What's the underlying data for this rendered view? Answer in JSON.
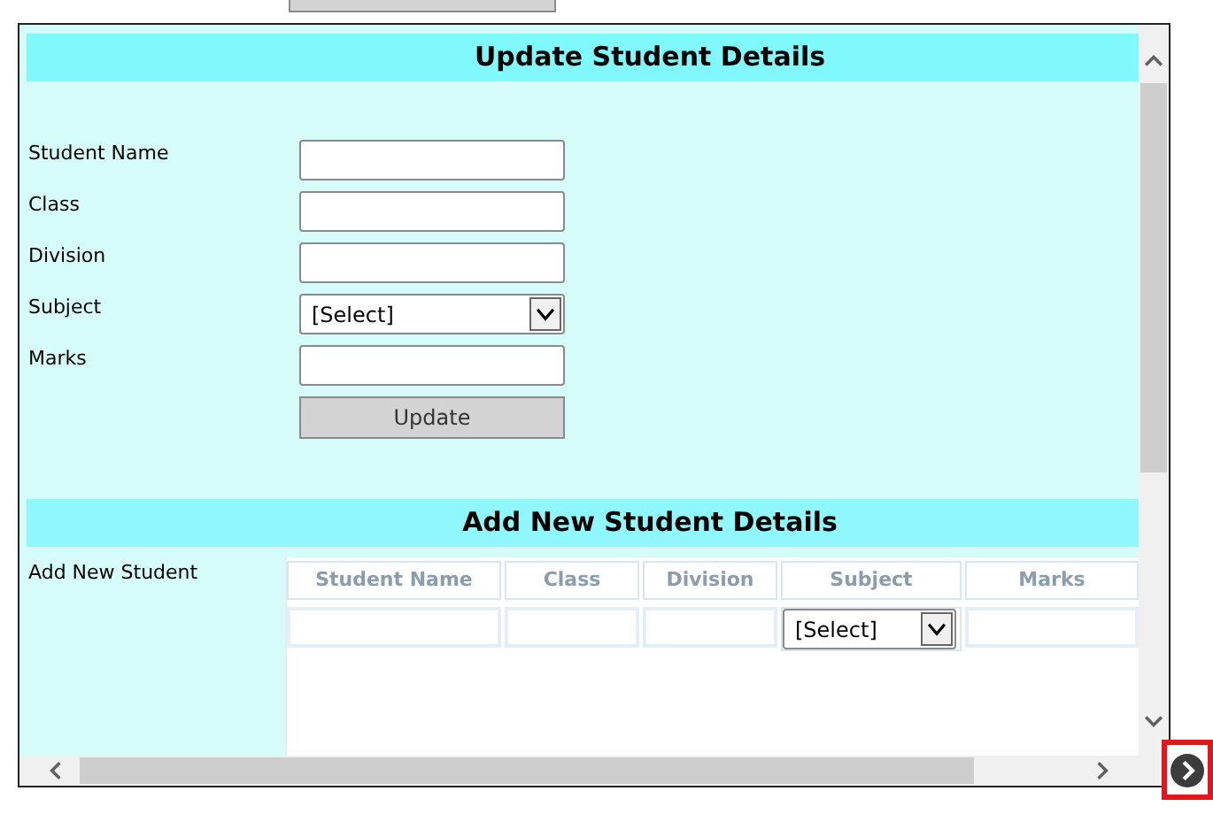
{
  "update_section": {
    "title": "Update Student Details",
    "fields": [
      {
        "label": "Student Name",
        "kind": "text"
      },
      {
        "label": "Class",
        "kind": "text"
      },
      {
        "label": "Division",
        "kind": "text"
      },
      {
        "label": "Subject",
        "kind": "select",
        "value": "[Select]"
      },
      {
        "label": "Marks",
        "kind": "text"
      }
    ],
    "button": "Update"
  },
  "add_section": {
    "title": "Add New Student Details",
    "label": "Add New Student",
    "table": {
      "columns": [
        "Student Name",
        "Class",
        "Division",
        "Subject",
        "Marks"
      ],
      "row": [
        {
          "kind": "text"
        },
        {
          "kind": "text"
        },
        {
          "kind": "text"
        },
        {
          "kind": "select",
          "value": "[Select]"
        },
        {
          "kind": "text"
        }
      ]
    }
  }
}
